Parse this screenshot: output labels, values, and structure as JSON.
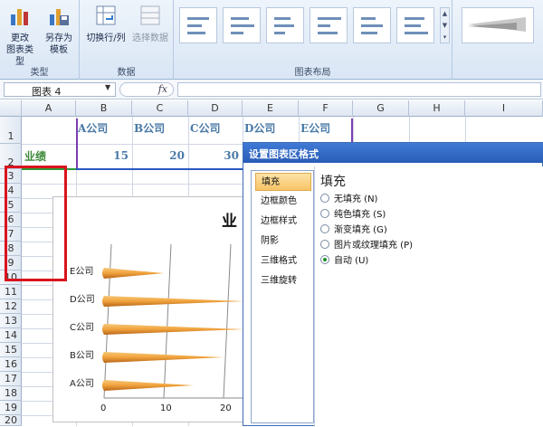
{
  "ribbon": {
    "type_group": {
      "label": "类型",
      "buttons": [
        {
          "label": "更改\n图表类型",
          "icon": "chart-type-icon"
        },
        {
          "label": "另存为\n模板",
          "icon": "save-template-icon"
        }
      ]
    },
    "data_group": {
      "label": "数据",
      "buttons": [
        {
          "label": "切换行/列",
          "icon": "switch-row-col-icon"
        },
        {
          "label": "选择数据",
          "icon": "select-data-icon"
        }
      ]
    },
    "layout_group": {
      "label": "图表布局"
    }
  },
  "formula_bar": {
    "name_box": "图表 4",
    "fx_label": "fx",
    "formula": ""
  },
  "grid": {
    "columns": [
      "A",
      "B",
      "C",
      "D",
      "E",
      "F",
      "G",
      "H",
      "I"
    ],
    "rows": [
      "1",
      "2",
      "3",
      "4",
      "5",
      "6",
      "7",
      "8",
      "9",
      "10",
      "11",
      "12",
      "13",
      "14",
      "15",
      "16",
      "17",
      "18",
      "19",
      "20"
    ],
    "headers": [
      "A公司",
      "B公司",
      "C公司",
      "D公司",
      "E公司"
    ],
    "row_label": "业绩",
    "values": [
      "15",
      "20",
      "30"
    ]
  },
  "chart": {
    "title_fragment": "业",
    "categories": [
      "E公司",
      "D公司",
      "C公司",
      "B公司",
      "A公司"
    ],
    "ticks": [
      "0",
      "10",
      "20"
    ]
  },
  "chart_data": {
    "type": "bar",
    "title": "业",
    "categories": [
      "A公司",
      "B公司",
      "C公司",
      "D公司",
      "E公司"
    ],
    "values": [
      15,
      20,
      30,
      25,
      10
    ],
    "xlim": [
      0,
      20
    ],
    "orientation": "horizontal",
    "shape": "cone",
    "color": "#f0a23c"
  },
  "dialog": {
    "title": "设置图表区格式",
    "nav": [
      "填充",
      "边框颜色",
      "边框样式",
      "阴影",
      "三维格式",
      "三维旋转"
    ],
    "active_nav": "填充",
    "pane_title": "填充",
    "options": [
      "无填充 (N)",
      "纯色填充 (S)",
      "渐变填充 (G)",
      "图片或纹理填充 (P)",
      "自动 (U)"
    ],
    "selected_option": "自动 (U)"
  }
}
